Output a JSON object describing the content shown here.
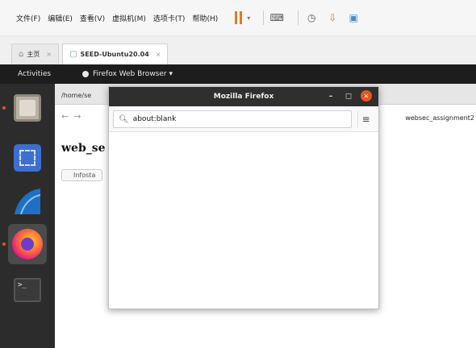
{
  "vmware": {
    "menu": [
      "文件(F)",
      "编辑(E)",
      "查看(V)",
      "虚拟机(M)",
      "选项卡(T)",
      "帮助(H)"
    ],
    "tabs": [
      {
        "label": "主页",
        "active": false
      },
      {
        "label": "SEED-Ubuntu20.04",
        "active": true
      }
    ],
    "tab_close_glyph": "×"
  },
  "ubuntu": {
    "activities": "Activities",
    "app_menu": "Firefox Web Browser ▾",
    "dock": [
      "files-icon",
      "screenshot-icon",
      "wireshark-icon",
      "firefox-icon",
      "terminal-icon"
    ],
    "terminal_glyph": ">_"
  },
  "background_window": {
    "title": "/home/se",
    "breadcrumb": "websec_assignment2",
    "heading": "web_se",
    "button_label": "Infosta"
  },
  "firefox_popup": {
    "title": "Mozilla Firefox",
    "minimize_glyph": "–",
    "maximize_glyph": "◻",
    "close_glyph": "✕",
    "url_value": "about:blank",
    "menu_glyph": "≡"
  },
  "colors": {
    "ubuntu_orange": "#e95420",
    "topbar": "#1d1d1d",
    "dock": "#2c2c2c"
  }
}
